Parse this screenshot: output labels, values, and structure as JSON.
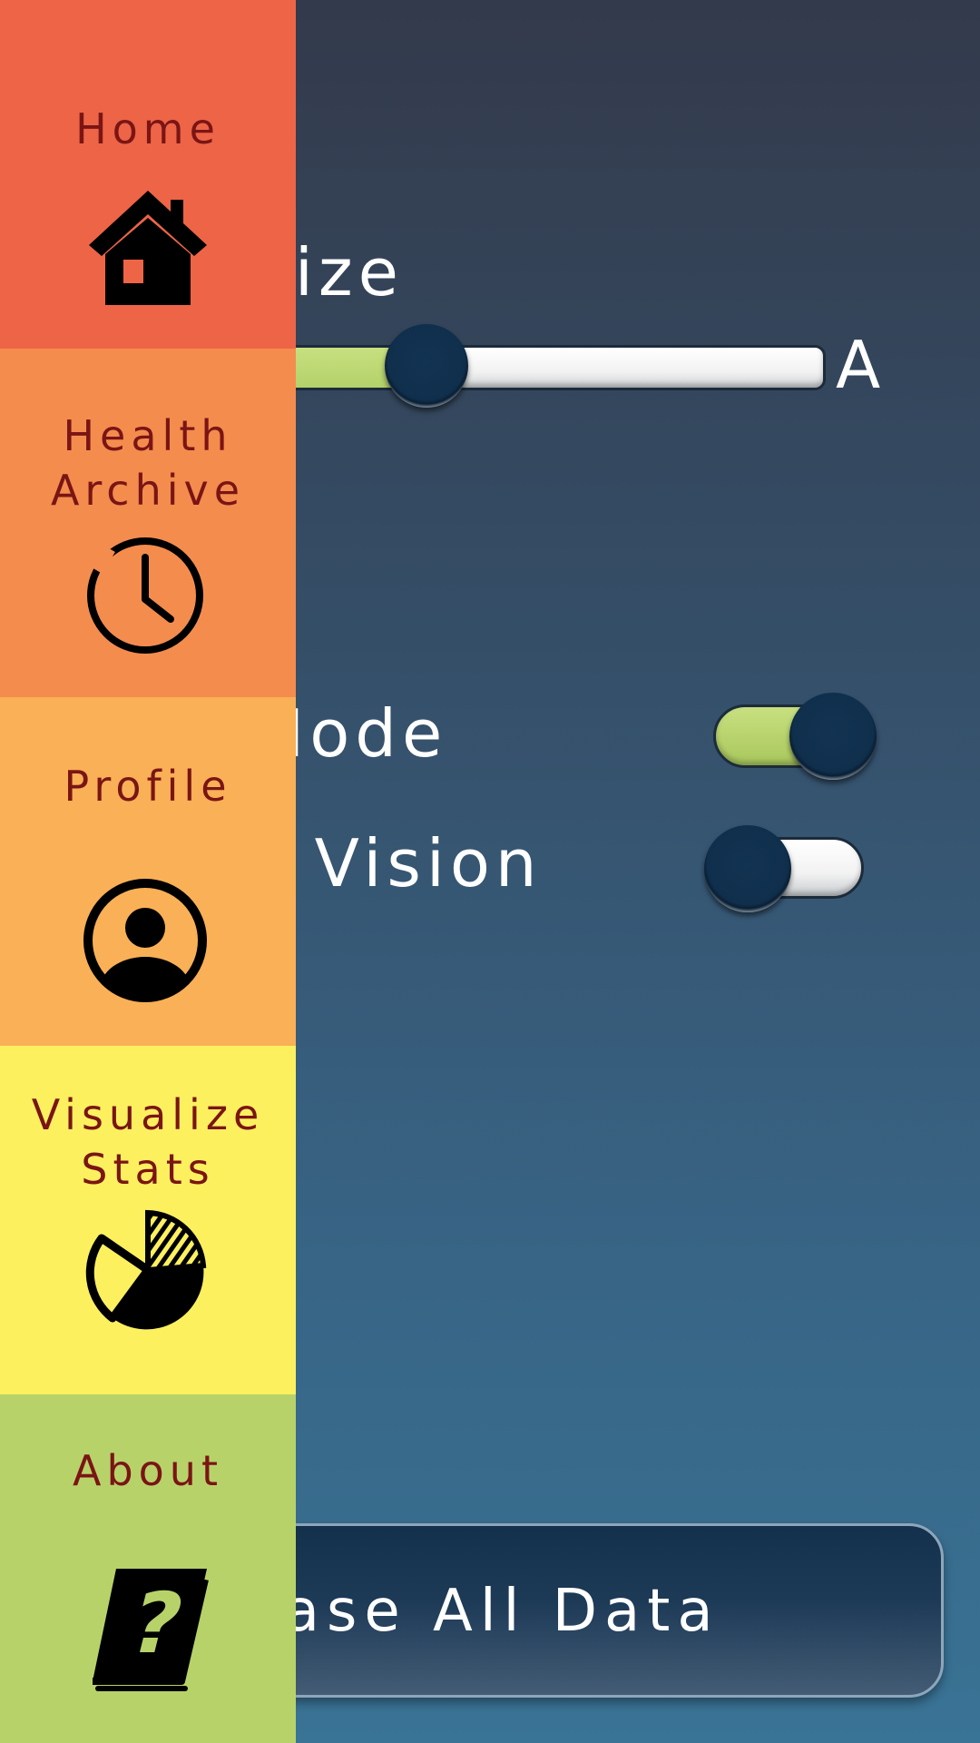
{
  "settings": {
    "font_size_label": "t Size",
    "slider_end_label": "A",
    "slider_value_fraction": 0.23,
    "night_mode_label": "t Mode",
    "night_mode_on": true,
    "tunnel_vision_label": "nal Vision",
    "tunnel_vision_on": false,
    "erase_button_label": "Erase All Data"
  },
  "nav": {
    "items": [
      {
        "line1": "Home",
        "line2": "",
        "icon": "home-icon",
        "color": "#ee6446"
      },
      {
        "line1": "Health",
        "line2": "Archive",
        "icon": "clock-icon",
        "color": "#f48c4e"
      },
      {
        "line1": "Profile",
        "line2": "",
        "icon": "user-circle-icon",
        "color": "#f9b056"
      },
      {
        "line1": "Visualize",
        "line2": "Stats",
        "icon": "pie-chart-icon",
        "color": "#fdf05f"
      },
      {
        "line1": "About",
        "line2": "",
        "icon": "help-book-icon",
        "color": "#b8d26a"
      }
    ]
  },
  "colors": {
    "toggle_on": "#b8d26a",
    "knob": "#0f2f4d",
    "nav_text": "#7a1515"
  }
}
